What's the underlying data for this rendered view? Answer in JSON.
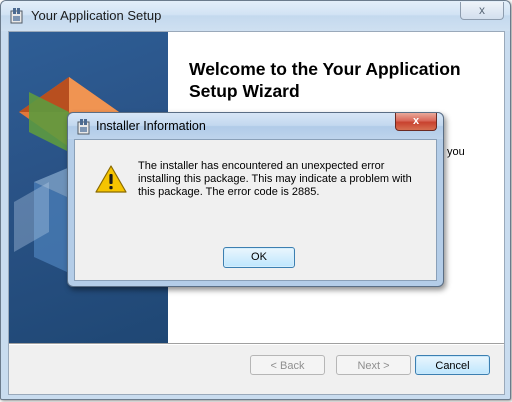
{
  "window": {
    "title": "Your Application Setup",
    "close_glyph": "x"
  },
  "wizard": {
    "welcome_heading": "Welcome to the Your Application Setup Wizard",
    "partial_text": "you"
  },
  "buttons": {
    "back": "< Back",
    "next": "Next >",
    "cancel": "Cancel"
  },
  "dialog": {
    "title": "Installer Information",
    "close_glyph": "x",
    "message": "The installer has encountered an unexpected error installing this package. This may indicate a problem with this package. The error code is 2885.",
    "ok": "OK",
    "icon": "warning-icon"
  },
  "colors": {
    "banner": "#2a5387",
    "dialog_close": "#c8422f",
    "warning": "#f5c400"
  }
}
